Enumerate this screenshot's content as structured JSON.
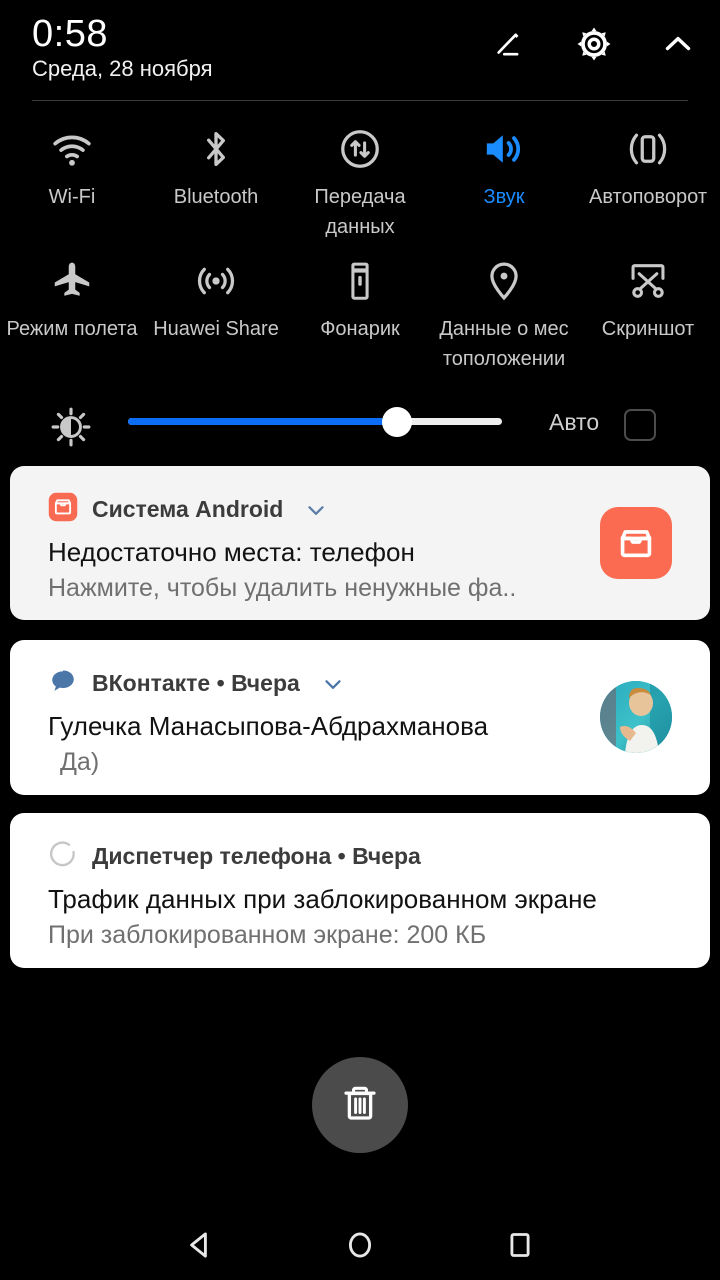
{
  "statusbar": {
    "time": "0:58",
    "date": "Среда, 28 ноября",
    "icons": [
      "edit-pencil-icon",
      "settings-gear-icon",
      "collapse-chevron-up-icon"
    ]
  },
  "quick_settings": {
    "row1": [
      {
        "label": "Wi-Fi",
        "icon": "wifi-icon",
        "active": false
      },
      {
        "label": "Bluetooth",
        "icon": "bluetooth-icon",
        "active": false
      },
      {
        "label": "Передача\nданных",
        "icon": "data-transfer-icon",
        "active": false
      },
      {
        "label": "Звук",
        "icon": "sound-speaker-icon",
        "active": true
      },
      {
        "label": "Автоповорот",
        "icon": "auto-rotate-icon",
        "active": false
      }
    ],
    "row2": [
      {
        "label": "Режим полета",
        "icon": "airplane-icon",
        "active": false
      },
      {
        "label": "Huawei Share",
        "icon": "huawei-share-icon",
        "active": false
      },
      {
        "label": "Фонарик",
        "icon": "flashlight-icon",
        "active": false
      },
      {
        "label": "Данные о мес\nтоположении",
        "icon": "location-pin-icon",
        "active": false
      },
      {
        "label": "Скриншот",
        "icon": "screenshot-scissors-icon",
        "active": false
      }
    ],
    "active_color": "#1a8cff",
    "inactive_color": "#c9c9c9"
  },
  "brightness": {
    "icon": "brightness-sun-icon",
    "value_percent": 72,
    "auto_label": "Авто",
    "auto_checked": false,
    "fill_color": "#0b6ef5",
    "track_color": "#eeeeee"
  },
  "notifications": [
    {
      "app": "Система Android",
      "time": "",
      "has_chevron": true,
      "title": "Недостаточно места: телефон",
      "body": "Нажмите, чтобы удалить ненужные фа..",
      "small_icon": "inbox-tray-icon",
      "small_icon_color": "#f96a52",
      "large_icon": "inbox-tray-icon",
      "large_icon_color": "#fa6b52",
      "card_tinted": true
    },
    {
      "app": "ВКонтакте",
      "time": "Вчера",
      "has_chevron": true,
      "title": "Гулечка Манасыпова-Абдрахманова",
      "body": "Да)",
      "small_icon": "chat-bubble-icon",
      "small_icon_color": "#4a76a8",
      "large_icon": "contact-avatar-photo",
      "large_icon_color": "#2fb4c4",
      "card_tinted": false
    },
    {
      "app": "Диспетчер телефона",
      "time": "Вчера",
      "has_chevron": false,
      "title": "Трафик данных при заблокированном экране",
      "body": "При заблокированном экране: 200 КБ",
      "small_icon": "loading-ring-icon",
      "small_icon_color": "#c0c0c0",
      "large_icon": "",
      "large_icon_color": "",
      "card_tinted": false
    }
  ],
  "clear_all": {
    "icon": "trash-can-icon",
    "background": "#4b4b4b"
  },
  "navbar": [
    {
      "icon": "back-triangle-icon"
    },
    {
      "icon": "home-circle-icon"
    },
    {
      "icon": "recents-square-icon"
    }
  ]
}
